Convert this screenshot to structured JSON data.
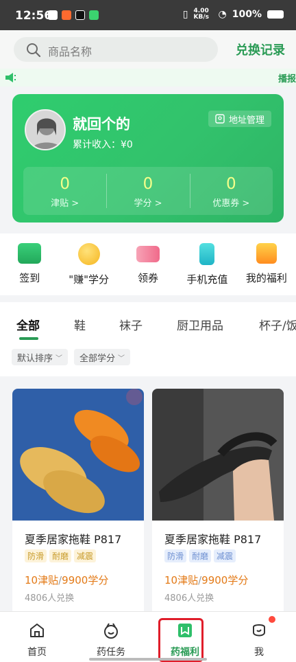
{
  "status": {
    "time": "12:56",
    "net": "4.00 KB/s",
    "battery": "100%"
  },
  "header": {
    "search_placeholder": "商品名称",
    "exchange_link": "兑换记录"
  },
  "marquee": {
    "text": "播报"
  },
  "user": {
    "name": "就回个的",
    "income_label": "累计收入：¥0",
    "address_button": "地址管理",
    "stats": [
      {
        "value": "0",
        "label": "津贴 >"
      },
      {
        "value": "0",
        "label": "学分 >"
      },
      {
        "value": "0",
        "label": "优惠券 >"
      }
    ]
  },
  "quick_actions": [
    {
      "label": "签到",
      "icon": "signin-icon",
      "color": "#2fbf6a"
    },
    {
      "label": "\"赚\"学分",
      "icon": "coin-icon",
      "color": "#f5b51f"
    },
    {
      "label": "领券",
      "icon": "ticket-icon",
      "color": "#f06a8a"
    },
    {
      "label": "手机充值",
      "icon": "phone-icon",
      "color": "#27c1c9"
    },
    {
      "label": "我的福利",
      "icon": "gift-icon",
      "color": "#ff8d1f"
    }
  ],
  "tabs": [
    "全部",
    "鞋",
    "袜子",
    "厨卫用品",
    "杯子/饭"
  ],
  "filters": [
    "默认排序",
    "全部学分"
  ],
  "products": [
    {
      "title": "夏季居家拖鞋 P817",
      "tags": [
        "防滑",
        "耐磨",
        "减震"
      ],
      "price_allowance": "10津贴",
      "price_credit": "9900学分",
      "sold": "4806人兑换"
    },
    {
      "title": "夏季居家拖鞋 P817",
      "tags": [
        "防滑",
        "耐磨",
        "减震"
      ],
      "price_allowance": "10津贴",
      "price_credit": "9900学分",
      "sold": "4806人兑换"
    }
  ],
  "bottom_nav": [
    {
      "label": "首页",
      "icon": "home-icon"
    },
    {
      "label": "药任务",
      "icon": "task-icon"
    },
    {
      "label": "药福利",
      "icon": "welfare-icon"
    },
    {
      "label": "我",
      "icon": "me-icon"
    }
  ],
  "colors": {
    "brand_green": "#2a9b55",
    "card_green": "#32c26c",
    "price_orange": "#e37a17",
    "highlight_red": "#e01d2a"
  }
}
